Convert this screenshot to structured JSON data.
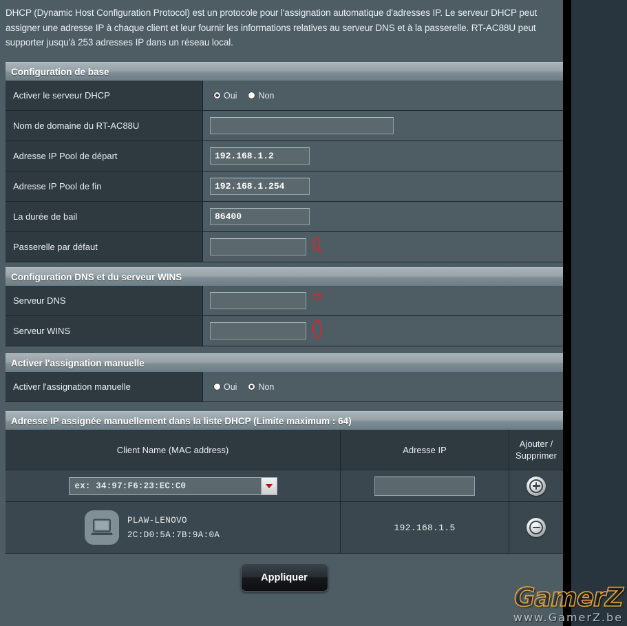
{
  "intro": {
    "text": "DHCP (Dynamic Host Configuration Protocol) est un protocole pour l'assignation automatique d'adresses IP. Le serveur DHCP peut assigner une adresse IP à chaque client et leur fournir les informations relatives au serveur DNS et à la passerelle. RT-AC88U peut supporter jusqu'à 253 adresses IP dans un réseau local."
  },
  "sections": {
    "basic": {
      "title": "Configuration de base",
      "rows": {
        "enable_dhcp": {
          "label": "Activer le serveur DHCP",
          "yes_label": "Oui",
          "no_label": "Non",
          "selected": "Oui"
        },
        "domain_name": {
          "label": "Nom de domaine du RT-AC88U",
          "value": "",
          "placeholder": ""
        },
        "pool_start": {
          "label": "Adresse IP Pool de départ",
          "value": "192.168.1.2"
        },
        "pool_end": {
          "label": "Adresse IP Pool de fin",
          "value": "192.168.1.254"
        },
        "lease_time": {
          "label": "La durée de bail",
          "value": "86400"
        },
        "default_gateway": {
          "label": "Passerelle par défaut",
          "value": ""
        }
      }
    },
    "dns": {
      "title": "Configuration DNS et du serveur WINS",
      "rows": {
        "dns_server": {
          "label": "Serveur DNS",
          "value": ""
        },
        "wins_server": {
          "label": "Serveur WINS",
          "value": ""
        }
      }
    },
    "manual": {
      "title": "Activer l'assignation manuelle",
      "rows": {
        "enable_manual": {
          "label": "Activer l'assignation manuelle",
          "yes_label": "Oui",
          "no_label": "Non",
          "selected": "Non"
        }
      }
    },
    "dhcp_list": {
      "title": "Adresse IP assignée manuellement dans la liste DHCP (Limite maximum : 64)",
      "columns": {
        "client": "Client Name (MAC address)",
        "ip": "Adresse IP",
        "action_line1": "Ajouter /",
        "action_line2": "Supprimer"
      },
      "new_entry": {
        "client_select_value": "ex: 34:97:F6:23:EC:C0",
        "ip_value": "",
        "add_icon": "plus-circle-icon"
      },
      "entries": [
        {
          "device_icon": "laptop-icon",
          "name": "PLAW-LENOVO",
          "mac": "2C:D0:5A:7B:9A:0A",
          "ip": "192.168.1.5",
          "remove_icon": "minus-circle-icon"
        }
      ]
    }
  },
  "apply_button": {
    "label": "Appliquer"
  },
  "watermark": {
    "line1": "GamerZ",
    "line2": "www.GamerZ.be"
  },
  "annotations": {
    "gateway_mark": "red-handdrawn-circle",
    "dns_mark": "red-handdrawn-circle",
    "wins_mark": "red-handdrawn-circle"
  },
  "colors": {
    "page_bg": "#28353f",
    "panel_bg": "#4e5d64",
    "label_col_bg": "#2e3940",
    "header_grad_top": "#a9b3b8",
    "header_grad_bottom": "#6d7d86",
    "text": "#e9eef0",
    "annotation_red": "#e32222",
    "select_arrow_red": "#b51017",
    "watermark_orange": "#e9a23b"
  }
}
